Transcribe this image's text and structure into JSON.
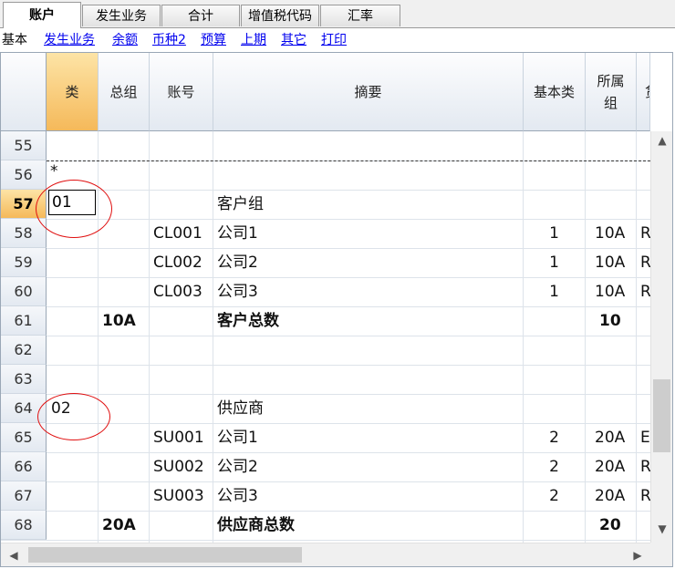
{
  "tabs": [
    "账户",
    "发生业务",
    "合计",
    "增值税代码",
    "汇率"
  ],
  "active_tab": "账户",
  "subbar": {
    "current": "基本",
    "links": [
      "发生业务",
      "余额",
      "币种2",
      "预算",
      "上期",
      "其它",
      "打印"
    ]
  },
  "columns": {
    "lei": "类",
    "zongzu": "总组",
    "zhanghao": "账号",
    "zhaiyao": "摘要",
    "jibenlei": "基本类",
    "suoshuzu": "所属组",
    "cut": "货"
  },
  "rows": [
    {
      "num": "55",
      "lei": "",
      "zongzu": "",
      "zhanghao": "",
      "zhaiyao": "",
      "jibenlei": "",
      "suoshuzu": "",
      "cut": "",
      "bold": false
    },
    {
      "num": "56",
      "lei": "*",
      "zongzu": "",
      "zhanghao": "",
      "zhaiyao": "",
      "jibenlei": "",
      "suoshuzu": "",
      "cut": "",
      "bold": false
    },
    {
      "num": "57",
      "lei": "01",
      "zongzu": "",
      "zhanghao": "",
      "zhaiyao": "客户组",
      "jibenlei": "",
      "suoshuzu": "",
      "cut": "",
      "bold": false
    },
    {
      "num": "58",
      "lei": "",
      "zongzu": "",
      "zhanghao": "CL001",
      "zhaiyao": "公司1",
      "jibenlei": "1",
      "suoshuzu": "10A",
      "cut": "R",
      "bold": false
    },
    {
      "num": "59",
      "lei": "",
      "zongzu": "",
      "zhanghao": "CL002",
      "zhaiyao": "公司2",
      "jibenlei": "1",
      "suoshuzu": "10A",
      "cut": "R",
      "bold": false
    },
    {
      "num": "60",
      "lei": "",
      "zongzu": "",
      "zhanghao": "CL003",
      "zhaiyao": "公司3",
      "jibenlei": "1",
      "suoshuzu": "10A",
      "cut": "R",
      "bold": false
    },
    {
      "num": "61",
      "lei": "",
      "zongzu": "10A",
      "zhanghao": "",
      "zhaiyao": "客户总数",
      "jibenlei": "",
      "suoshuzu": "10",
      "cut": "",
      "bold": true
    },
    {
      "num": "62",
      "lei": "",
      "zongzu": "",
      "zhanghao": "",
      "zhaiyao": "",
      "jibenlei": "",
      "suoshuzu": "",
      "cut": "",
      "bold": false
    },
    {
      "num": "63",
      "lei": "",
      "zongzu": "",
      "zhanghao": "",
      "zhaiyao": "",
      "jibenlei": "",
      "suoshuzu": "",
      "cut": "",
      "bold": false
    },
    {
      "num": "64",
      "lei": "02",
      "zongzu": "",
      "zhanghao": "",
      "zhaiyao": "供应商",
      "jibenlei": "",
      "suoshuzu": "",
      "cut": "",
      "bold": false
    },
    {
      "num": "65",
      "lei": "",
      "zongzu": "",
      "zhanghao": "SU001",
      "zhaiyao": "公司1",
      "jibenlei": "2",
      "suoshuzu": "20A",
      "cut": "E",
      "bold": false
    },
    {
      "num": "66",
      "lei": "",
      "zongzu": "",
      "zhanghao": "SU002",
      "zhaiyao": "公司2",
      "jibenlei": "2",
      "suoshuzu": "20A",
      "cut": "R",
      "bold": false
    },
    {
      "num": "67",
      "lei": "",
      "zongzu": "",
      "zhanghao": "SU003",
      "zhaiyao": "公司3",
      "jibenlei": "2",
      "suoshuzu": "20A",
      "cut": "R",
      "bold": false
    },
    {
      "num": "68",
      "lei": "",
      "zongzu": "20A",
      "zhanghao": "",
      "zhaiyao": "供应商总数",
      "jibenlei": "",
      "suoshuzu": "20",
      "cut": "",
      "bold": true
    }
  ],
  "selected_row": "57",
  "editing_value": "01",
  "colors": {
    "highlight": "#f5b95a",
    "annotation": "#e01010",
    "link": "#0000ee"
  },
  "icons": {
    "scroll_up": "triangle-up",
    "scroll_down": "triangle-down",
    "scroll_left": "triangle-left",
    "scroll_right": "triangle-right"
  }
}
